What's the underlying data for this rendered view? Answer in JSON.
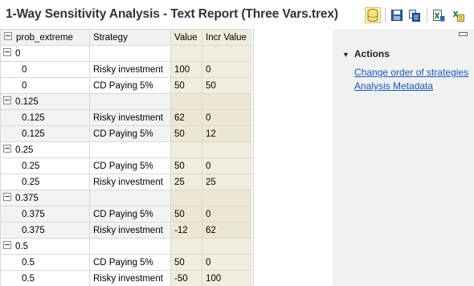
{
  "header": {
    "title": "1-Way Sensitivity Analysis - Text Report (Three Vars.trex)",
    "toolbar": [
      {
        "icon": "database-icon",
        "active": true
      },
      {
        "icon": "save-icon"
      },
      {
        "icon": "copy-icon"
      },
      {
        "icon": "export-excel-icon"
      },
      {
        "icon": "export-options-icon"
      }
    ]
  },
  "table": {
    "columns": [
      "prob_extreme",
      "Strategy",
      "Value",
      "Incr Value"
    ],
    "groups": [
      {
        "label": "0",
        "rows": [
          {
            "param": "0",
            "strategy": "Risky investment",
            "value": "100",
            "incr": "0"
          },
          {
            "param": "0",
            "strategy": "CD Paying 5%",
            "value": "50",
            "incr": "50"
          }
        ]
      },
      {
        "label": "0.125",
        "rows": [
          {
            "param": "0.125",
            "strategy": "Risky investment",
            "value": "62",
            "incr": "0"
          },
          {
            "param": "0.125",
            "strategy": "CD Paying 5%",
            "value": "50",
            "incr": "12"
          }
        ]
      },
      {
        "label": "0.25",
        "rows": [
          {
            "param": "0.25",
            "strategy": "CD Paying 5%",
            "value": "50",
            "incr": "0"
          },
          {
            "param": "0.25",
            "strategy": "Risky investment",
            "value": "25",
            "incr": "25"
          }
        ]
      },
      {
        "label": "0.375",
        "rows": [
          {
            "param": "0.375",
            "strategy": "CD Paying 5%",
            "value": "50",
            "incr": "0"
          },
          {
            "param": "0.375",
            "strategy": "Risky investment",
            "value": "-12",
            "incr": "62"
          }
        ]
      },
      {
        "label": "0.5",
        "rows": [
          {
            "param": "0.5",
            "strategy": "CD Paying 5%",
            "value": "50",
            "incr": "0"
          },
          {
            "param": "0.5",
            "strategy": "Risky investment",
            "value": "-50",
            "incr": "100"
          }
        ]
      }
    ]
  },
  "actions": {
    "heading": "Actions",
    "links": [
      "Change order of strategies",
      "Analysis Metadata"
    ]
  },
  "colors": {
    "link": "#1a57b7",
    "value_column": "#f0eddc",
    "panel": "#f1f1f1"
  }
}
